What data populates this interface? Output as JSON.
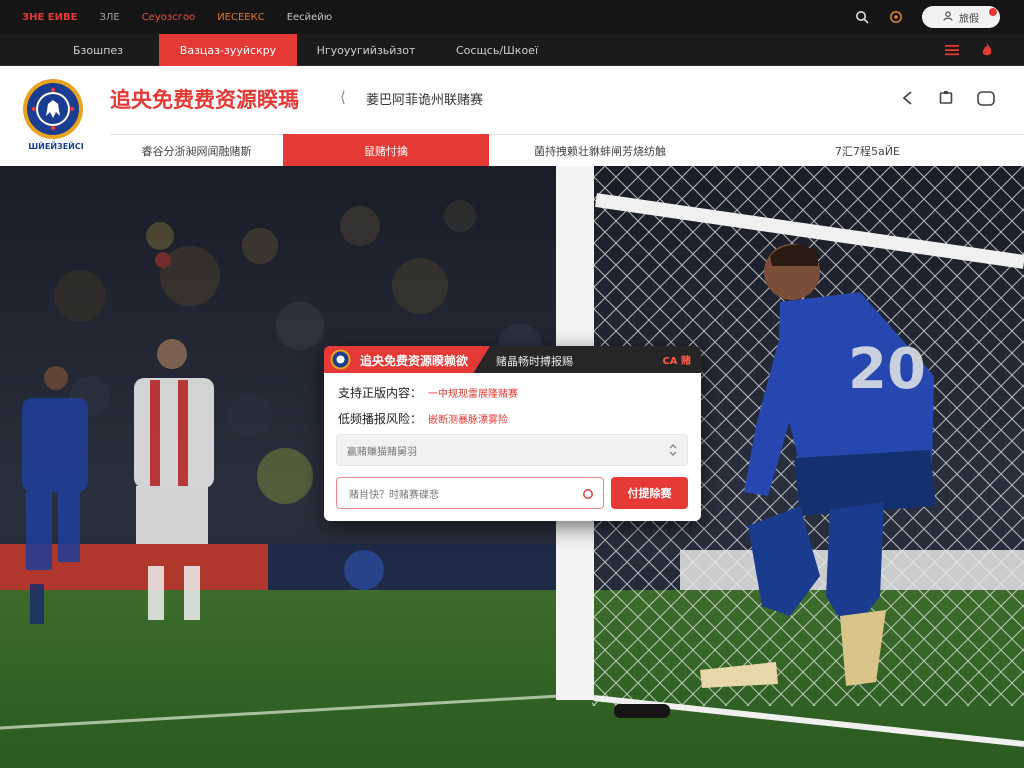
{
  "topbar": {
    "brand": "ЗНЕ ЕИВЕ",
    "links": [
      "ЗЛЕ",
      "Сеуозсгоо",
      "ИЕСЕЕКС",
      "Еесйейю"
    ],
    "login_label": "旅假"
  },
  "nav": {
    "tabs": [
      "Бзошпез",
      "Вазцаз-зууйскру",
      "Нгуоуугийзьйзот",
      "Сосщсь/Шкоеї"
    ],
    "active_index": 1
  },
  "header": {
    "crest_caption": "ШЙЕЙЗЕЙСІ",
    "title": "追央免费费资源睽瑪",
    "separator": "⟨",
    "subtitle": "菨巴阿菲诡州联赌赛",
    "subnav": [
      "睿谷分浙昶网闻融赌斯",
      "鼠赌忖擒",
      "菌持拽赖壮貅蚌闸芳烧纺触",
      "7汇7程5аЙЕ"
    ],
    "subnav_active_index": 1
  },
  "dialog": {
    "title": "追央免费资源睽赖欲",
    "subtitle": "赌晶畅时搏报赐",
    "badge": "СА 赌",
    "row1_label": "支持正版内容：",
    "row1_value": "一中规现雷展隆赌赛",
    "row2_label": "低频播报风险：",
    "row2_value": "嵌断测暴脉漂雾险",
    "select_placeholder": "赢赌賺猫赌舅羽",
    "input_placeholder": "赌肖快？时赌赛碟悲",
    "submit_label": "付提除赛"
  },
  "colors": {
    "accent": "#e53935",
    "dark": "#1b1b1b",
    "chelsea_blue": "#1b3d91"
  },
  "icons": [
    "search-icon",
    "settings-icon",
    "user-icon",
    "menu-icon",
    "flame-icon",
    "back-icon",
    "bookmark-icon",
    "chat-icon",
    "chevron-updown-icon",
    "refresh-ring-icon"
  ]
}
